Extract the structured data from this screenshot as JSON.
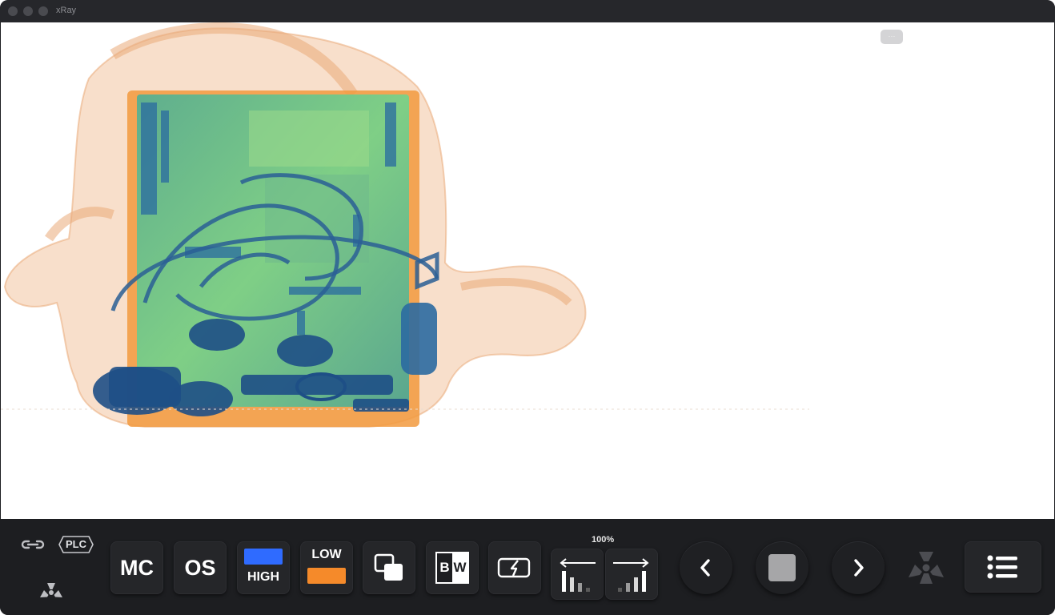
{
  "window": {
    "title": "xRay"
  },
  "viewer": {
    "more_label": "···"
  },
  "status": {
    "link_icon": "link-icon",
    "plc_label": "PLC",
    "radiation_icon": "radiation-icon"
  },
  "toolbar": {
    "mc_label": "MC",
    "os_label": "OS",
    "high_label": "HIGH",
    "high_color": "#2f6bff",
    "low_label": "LOW",
    "low_color": "#f58a2a",
    "overlay_icon": "overlay-squares-icon",
    "bw_label_b": "B",
    "bw_label_w": "W",
    "flash_icon": "flash-battery-icon",
    "zoom_level": "100%",
    "decrease_icon": "decrease-contrast-icon",
    "increase_icon": "increase-contrast-icon",
    "prev_icon": "chevron-left-icon",
    "stop_icon": "stop-icon",
    "next_icon": "chevron-right-icon",
    "radiation_icon": "radiation-icon",
    "menu_icon": "list-menu-icon"
  },
  "colors": {
    "organic": "#f0b98a",
    "inorganic": "#6fcf8a",
    "metal": "#1f5f9c"
  }
}
